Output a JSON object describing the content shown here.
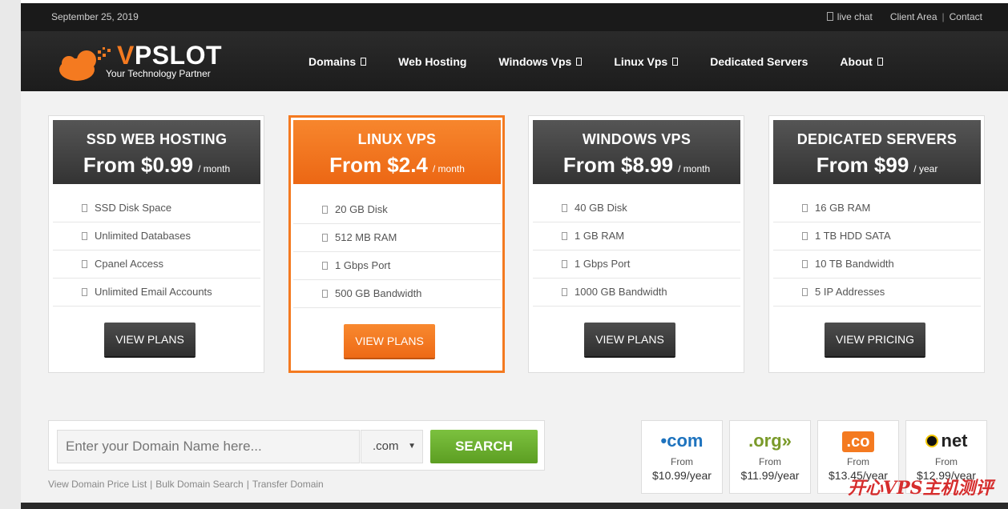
{
  "topbar": {
    "date": "September 25, 2019",
    "live_chat": "live chat",
    "client_area": "Client Area",
    "separator": "|",
    "contact": "Contact"
  },
  "logo": {
    "brand_v": "V",
    "brand_rest": "PSLOT",
    "tagline": "Your Technology Partner"
  },
  "nav": {
    "items": [
      {
        "label": "Domains",
        "dropdown": true
      },
      {
        "label": "Web Hosting",
        "dropdown": false
      },
      {
        "label": "Windows Vps",
        "dropdown": true
      },
      {
        "label": "Linux Vps",
        "dropdown": true
      },
      {
        "label": "Dedicated Servers",
        "dropdown": false
      },
      {
        "label": "About",
        "dropdown": true
      }
    ]
  },
  "plans": [
    {
      "title": "SSD WEB HOSTING",
      "price": "From $0.99",
      "period": "/ month",
      "features": [
        "SSD Disk Space",
        "Unlimited Databases",
        "Cpanel Access",
        "Unlimited Email Accounts"
      ],
      "button": "VIEW PLANS",
      "featured": false
    },
    {
      "title": "LINUX VPS",
      "price": "From $2.4",
      "period": "/ month",
      "features": [
        "20 GB Disk",
        "512 MB RAM",
        "1 Gbps Port",
        "500 GB Bandwidth"
      ],
      "button": "VIEW PLANS",
      "featured": true
    },
    {
      "title": "WINDOWS VPS",
      "price": "From $8.99",
      "period": "/ month",
      "features": [
        "40 GB Disk",
        "1 GB RAM",
        "1 Gbps Port",
        "1000 GB Bandwidth"
      ],
      "button": "VIEW PLANS",
      "featured": false
    },
    {
      "title": "DEDICATED SERVERS",
      "price": "From $99",
      "period": "/ year",
      "features": [
        "16 GB RAM",
        "1 TB HDD SATA",
        "10 TB Bandwidth",
        "5 IP Addresses"
      ],
      "button": "VIEW PRICING",
      "featured": false
    }
  ],
  "domain_search": {
    "placeholder": "Enter your Domain Name here...",
    "value": "",
    "tld_selected": ".com",
    "search_label": "SEARCH",
    "links": [
      "View Domain Price List",
      "Bulk Domain Search",
      "Transfer Domain"
    ],
    "separator": "|"
  },
  "tlds": [
    {
      "name": "com",
      "prefix": "•",
      "from": "From",
      "price": "$10.99/year"
    },
    {
      "name": ".org",
      "suffix": "»",
      "from": "From",
      "price": "$11.99/year"
    },
    {
      "name": ".co",
      "from": "From",
      "price": "$13.45/year"
    },
    {
      "name": "net",
      "from": "From",
      "price": "$12.99/year"
    }
  ],
  "watermark": "开心VPS主机测评",
  "colors": {
    "accent_orange": "#f47a20",
    "search_green": "#6aad2e",
    "dark": "#333333"
  }
}
